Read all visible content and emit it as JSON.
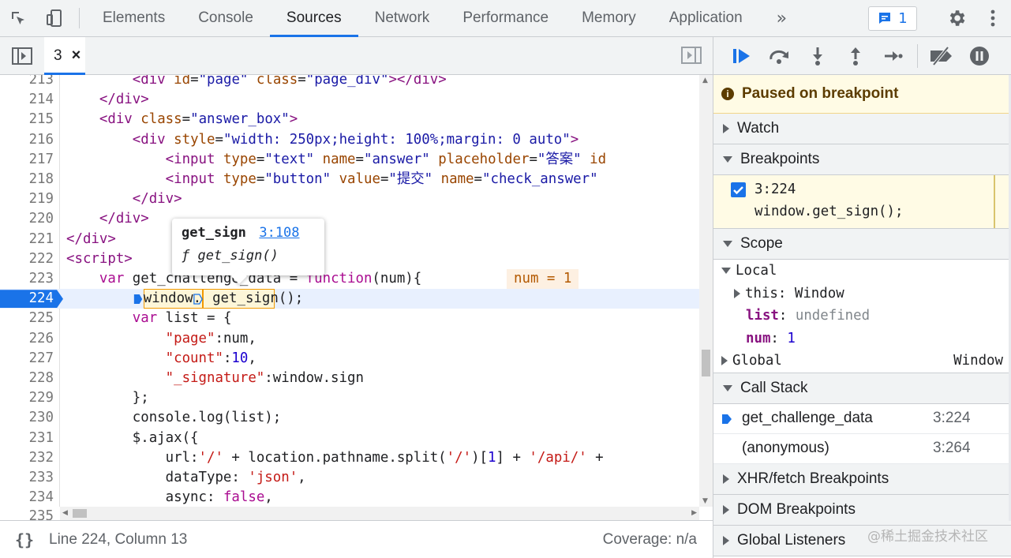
{
  "tabs": [
    "Elements",
    "Console",
    "Sources",
    "Network",
    "Performance",
    "Memory",
    "Application"
  ],
  "active_tab": "Sources",
  "more_tabs_glyph": "»",
  "issues_count": "1",
  "file_tab": {
    "name": "3",
    "close": "×"
  },
  "code_lines": [
    {
      "n": "213",
      "html": "        <span class='tag'>&lt;div</span> <span class='attr'>id</span>=<span class='str'>\"page\"</span> <span class='attr'>class</span>=<span class='str'>\"page_div\"</span><span class='tag'>&gt;&lt;/div&gt;</span>"
    },
    {
      "n": "214",
      "html": "    <span class='tag'>&lt;/div&gt;</span>"
    },
    {
      "n": "215",
      "html": "    <span class='tag'>&lt;div</span> <span class='attr'>class</span>=<span class='str'>\"answer_box\"</span><span class='tag'>&gt;</span>"
    },
    {
      "n": "216",
      "html": "        <span class='tag'>&lt;div</span> <span class='attr'>style</span>=<span class='str'>\"width: 250px;height: 100%;margin: 0 auto\"</span><span class='tag'>&gt;</span>"
    },
    {
      "n": "217",
      "html": "            <span class='tag'>&lt;input</span> <span class='attr'>type</span>=<span class='str'>\"text\"</span> <span class='attr'>name</span>=<span class='str'>\"answer\"</span> <span class='attr'>placeholder</span>=<span class='str'>\"答案\"</span> <span class='attr'>id</span>"
    },
    {
      "n": "218",
      "html": "            <span class='tag'>&lt;input</span> <span class='attr'>type</span>=<span class='str'>\"button\"</span> <span class='attr'>value</span>=<span class='str'>\"提交\"</span> <span class='attr'>name</span>=<span class='str'>\"check_answer\"</span>"
    },
    {
      "n": "219",
      "html": "        <span class='tag'>&lt;/div&gt;</span>"
    },
    {
      "n": "220",
      "html": "    <span class='tag'>&lt;/div&gt;</span>"
    },
    {
      "n": "221",
      "html": "<span class='tag'>&lt;/div&gt;</span>"
    },
    {
      "n": "222",
      "html": "<span class='tag'>&lt;script&gt;</span>"
    },
    {
      "n": "223",
      "html": "    <span class='kw'>var</span> get_challenge_data = <span class='kw'>function</span>(num){"
    },
    {
      "n": "224",
      "html": "        window.get_sign();"
    },
    {
      "n": "225",
      "html": "        <span class='kw'>var</span> list = {"
    },
    {
      "n": "226",
      "html": "            <span class='strjs'>\"page\"</span>:num,"
    },
    {
      "n": "227",
      "html": "            <span class='strjs'>\"count\"</span>:<span class='num'>10</span>,"
    },
    {
      "n": "228",
      "html": "            <span class='strjs'>\"_signature\"</span>:window.sign"
    },
    {
      "n": "229",
      "html": "        };"
    },
    {
      "n": "230",
      "html": "        console.log(list);"
    },
    {
      "n": "231",
      "html": "        $.ajax({"
    },
    {
      "n": "232",
      "html": "            url:<span class='strjs'>'/'</span> + location.pathname.split(<span class='strjs'>'/'</span>)[<span class='num'>1</span>] + <span class='strjs'>'/api/'</span> +"
    },
    {
      "n": "233",
      "html": "            dataType: <span class='strjs'>'json'</span>,"
    },
    {
      "n": "234",
      "html": "            async: <span class='kw'>false</span>,"
    }
  ],
  "partial_line_number": "235",
  "inline_value": "num = 1",
  "popover": {
    "name": "get_sign",
    "link": "3:108",
    "signature": "ƒ get_sign()"
  },
  "status": {
    "position": "Line 224, Column 13",
    "coverage": "Coverage: n/a",
    "braces": "{}"
  },
  "paused_message": "Paused on breakpoint",
  "sections": {
    "watch": "Watch",
    "breakpoints": "Breakpoints",
    "scope": "Scope",
    "call_stack": "Call Stack",
    "xhr": "XHR/fetch Breakpoints",
    "dom": "DOM Breakpoints",
    "global_listeners": "Global Listeners"
  },
  "breakpoint": {
    "location": "3:224",
    "code": "window.get_sign();"
  },
  "scope": {
    "local": "Local",
    "this_key": "this",
    "this_val": "Window",
    "list_key": "list",
    "list_val": "undefined",
    "num_key": "num",
    "num_val": "1",
    "global": "Global",
    "global_val": "Window"
  },
  "call_stack": [
    {
      "fn": "get_challenge_data",
      "loc": "3:224"
    },
    {
      "fn": "(anonymous)",
      "loc": "3:264"
    }
  ],
  "watermark": "@稀土掘金技术社区",
  "colors": {
    "accent": "#1a73e8",
    "paused_bg": "#fffbe5"
  }
}
